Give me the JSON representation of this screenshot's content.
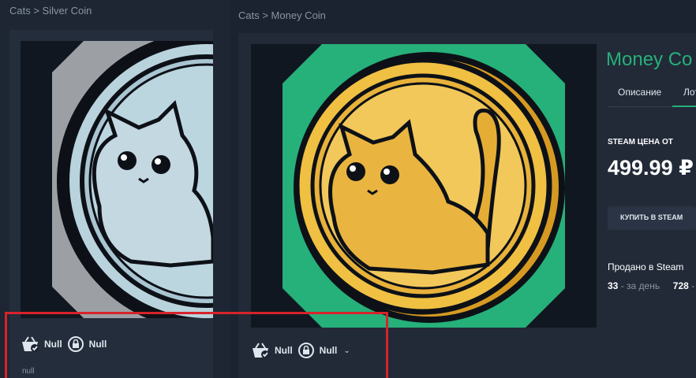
{
  "left_card": {
    "breadcrumb": "Cats > Silver Coin",
    "buy_value": "Null",
    "lock_value": "Null",
    "note": "null"
  },
  "right_card": {
    "breadcrumb": "Cats > Money Coin",
    "buy_value": "Null",
    "lock_value": "Null"
  },
  "details": {
    "title": "Money Co",
    "tabs": [
      "Описание",
      "Лот"
    ],
    "active_tab": "Лот",
    "steam_price_label": "STEAM ЦЕНА ОТ",
    "steam_price": "499.99 ₽",
    "buy_button": "КУПИТЬ В STEAM",
    "sold_label": "Продано в Steam",
    "sold_day_value": "33",
    "sold_day_label": "- за день",
    "sold_other_value": "728",
    "sold_other_label": "-"
  },
  "colors": {
    "accent": "#26b07a",
    "highlight": "#d8232a",
    "gold": "#f0c043",
    "silver": "#b9d3dd"
  },
  "icons": [
    "basket-check-icon",
    "lock-refresh-icon",
    "chevron-down-icon"
  ]
}
